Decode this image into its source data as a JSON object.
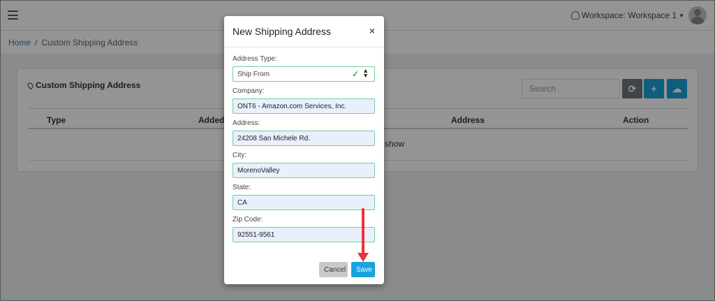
{
  "topbar": {
    "workspace_label": "Workspace: Workspace 1"
  },
  "breadcrumb": {
    "home": "Home",
    "separator": "/",
    "current": "Custom Shipping Address"
  },
  "card": {
    "title": "Custom Shipping Address",
    "search_placeholder": "Search",
    "columns": [
      "Type",
      "Added I",
      "Address",
      "Action"
    ],
    "empty_text_fragment": "o show"
  },
  "modal": {
    "title": "New Shipping Address",
    "close_label": "×",
    "fields": {
      "address_type": {
        "label": "Address Type:",
        "value": "Ship From"
      },
      "company": {
        "label": "Company:",
        "value": "ONT6 - Amazon.com Services, Inc."
      },
      "address": {
        "label": "Address:",
        "value": "24208 San Michele Rd."
      },
      "city": {
        "label": "City:",
        "value": "MorenoValley"
      },
      "state": {
        "label": "State:",
        "value": "CA"
      },
      "zip": {
        "label": "Zip Code:",
        "value": "92551-9561"
      }
    },
    "cancel_label": "Cancel",
    "save_label": "Save"
  },
  "colors": {
    "accent": "#1ba3dd",
    "valid_border": "#6fcf97",
    "annotation_arrow": "#e8343b"
  }
}
